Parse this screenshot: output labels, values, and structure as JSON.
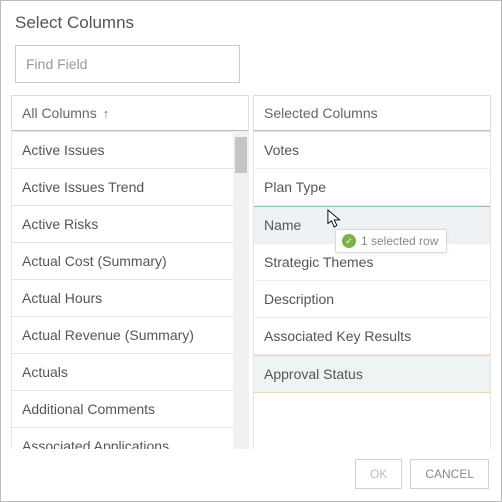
{
  "dialog": {
    "title": "Select Columns"
  },
  "search": {
    "placeholder": "Find Field",
    "value": ""
  },
  "left": {
    "header": "All Columns",
    "items": [
      "Active Issues",
      "Active Issues Trend",
      "Active Risks",
      "Actual Cost (Summary)",
      "Actual Hours",
      "Actual Revenue (Summary)",
      "Actuals",
      "Additional Comments",
      "Associated Applications"
    ]
  },
  "right": {
    "header": "Selected Columns",
    "items": [
      "Votes",
      "Plan Type",
      "Name",
      "Strategic Themes",
      "Description",
      "Associated Key Results",
      "Approval Status"
    ],
    "hover_index": 2,
    "selected_index": 6
  },
  "tooltip": {
    "text": "1 selected row"
  },
  "footer": {
    "ok": "OK",
    "cancel": "CANCEL"
  },
  "icons": {
    "sort_asc": "↑",
    "check": "✓"
  }
}
